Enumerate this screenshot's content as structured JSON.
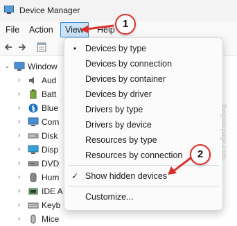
{
  "window": {
    "title": "Device Manager"
  },
  "menubar": {
    "file": "File",
    "action": "Action",
    "view": "View",
    "help": "Help"
  },
  "toolbar": {
    "icons": [
      "back-arrow-icon",
      "forward-arrow-icon",
      "properties-icon"
    ]
  },
  "tree": {
    "root": "Window",
    "items": [
      {
        "label": "Aud",
        "icon": "speaker-icon"
      },
      {
        "label": "Batt",
        "icon": "battery-icon"
      },
      {
        "label": "Blue",
        "icon": "bluetooth-icon"
      },
      {
        "label": "Com",
        "icon": "monitor-icon"
      },
      {
        "label": "Disk",
        "icon": "disk-drive-icon"
      },
      {
        "label": "Disp",
        "icon": "display-adapter-icon"
      },
      {
        "label": "DVD",
        "icon": "dvd-drive-icon"
      },
      {
        "label": "Hum",
        "icon": "hid-icon"
      },
      {
        "label": "IDE A",
        "icon": "ide-controller-icon"
      },
      {
        "label": "Keyb",
        "icon": "keyboard-icon"
      },
      {
        "label": "Mice",
        "icon": "mouse-icon"
      }
    ]
  },
  "view_menu": {
    "items": [
      {
        "label": "Devices by type",
        "mark": "•"
      },
      {
        "label": "Devices by connection",
        "mark": ""
      },
      {
        "label": "Devices by container",
        "mark": ""
      },
      {
        "label": "Devices by driver",
        "mark": ""
      },
      {
        "label": "Drivers by type",
        "mark": ""
      },
      {
        "label": "Drivers by device",
        "mark": ""
      },
      {
        "label": "Resources by type",
        "mark": ""
      },
      {
        "label": "Resources by connection",
        "mark": ""
      },
      {
        "label": "Show hidden devices",
        "mark": "✓"
      },
      {
        "label": "Customize...",
        "mark": ""
      }
    ]
  },
  "callouts": {
    "first": "1",
    "second": "2"
  },
  "watermark": "thegeekpage.com",
  "colors": {
    "accent": "#d9302c",
    "menu_highlight": "#cce4f7"
  }
}
